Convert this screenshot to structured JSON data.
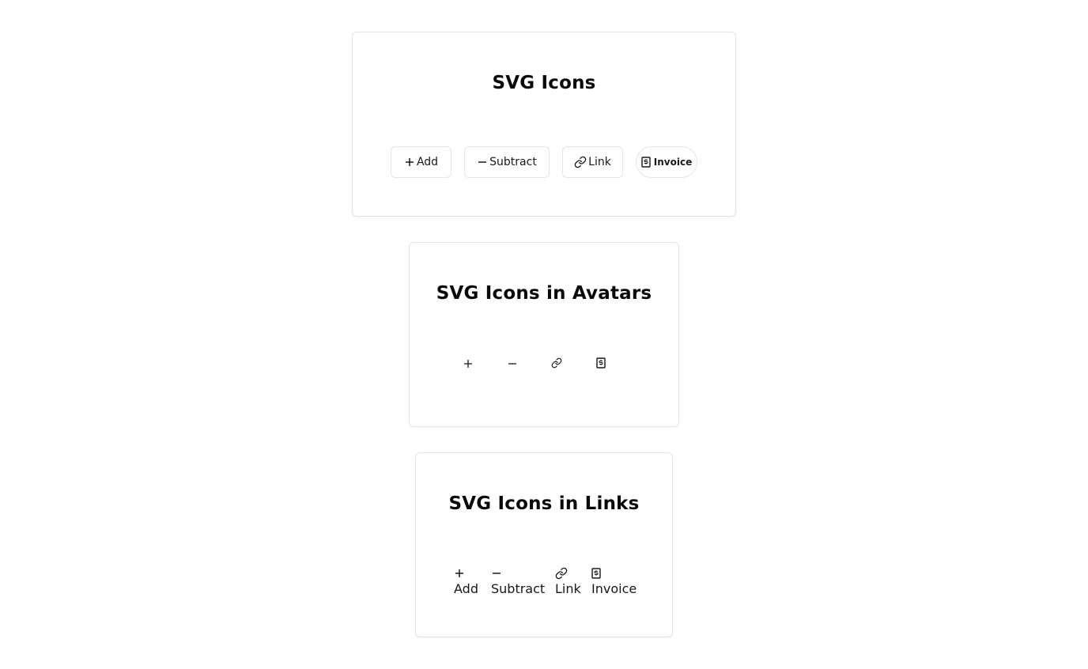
{
  "sections": {
    "icons": {
      "title": "SVG Icons",
      "buttons": [
        {
          "label": "Add",
          "icon": "plus-icon"
        },
        {
          "label": "Subtract",
          "icon": "minus-icon"
        },
        {
          "label": "Link",
          "icon": "link-icon"
        },
        {
          "label": "Invoice",
          "icon": "invoice-icon"
        }
      ]
    },
    "avatars": {
      "title": "SVG Icons in Avatars",
      "icons": [
        "plus-icon",
        "minus-icon",
        "link-icon",
        "invoice-icon"
      ]
    },
    "links": {
      "title": "SVG Icons in Links",
      "items": [
        {
          "label": "Add",
          "icon": "plus-icon"
        },
        {
          "label": "Subtract",
          "icon": "minus-icon"
        },
        {
          "label": "Link",
          "icon": "link-icon"
        },
        {
          "label": "Invoice",
          "icon": "invoice-icon"
        }
      ]
    }
  },
  "colors": {
    "text": "#18181b",
    "border": "#e4e4e7",
    "background": "#ffffff"
  }
}
